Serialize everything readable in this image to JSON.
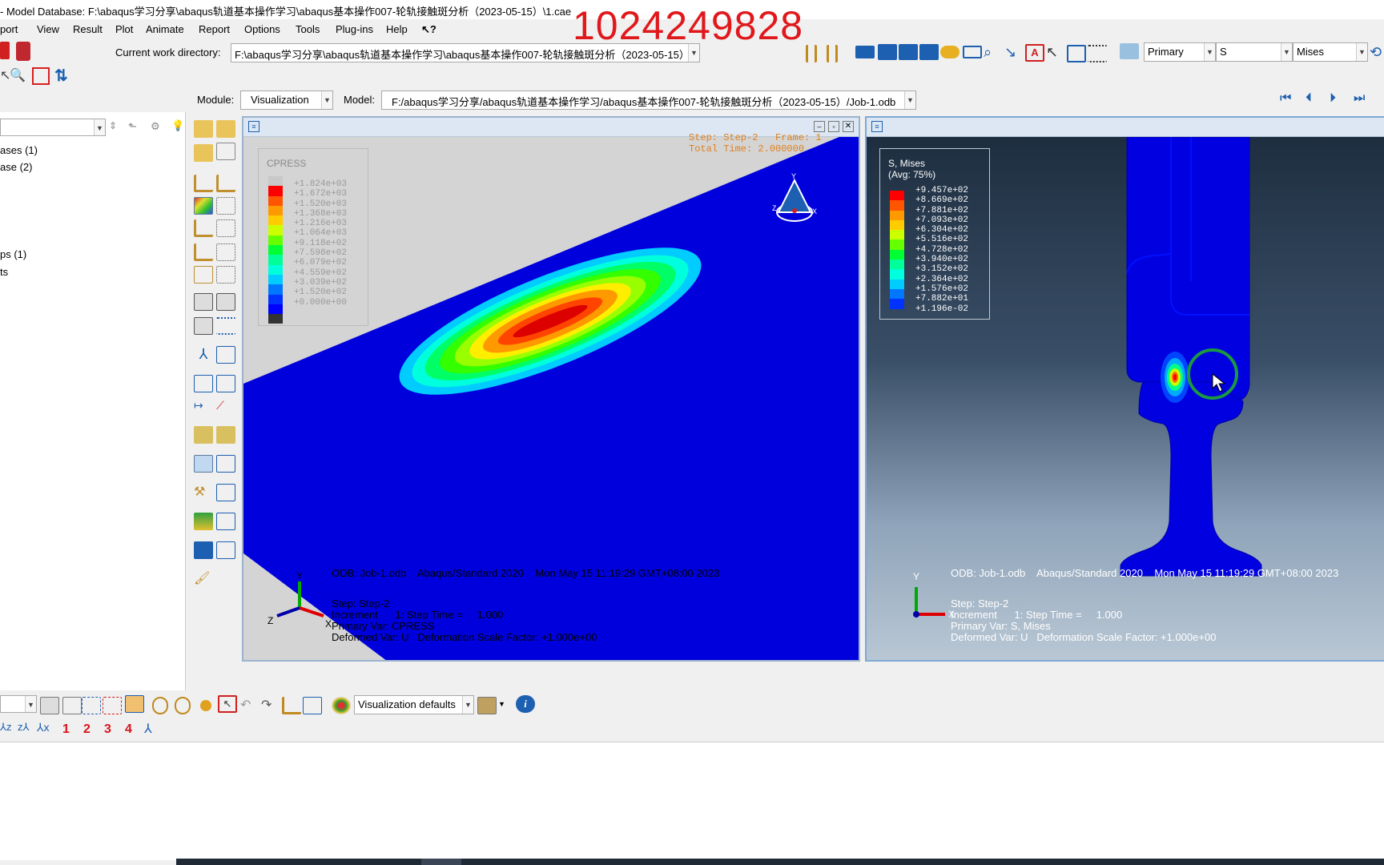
{
  "window": {
    "title": "- Model Database: F:\\abaqus学习分享\\abaqus轨道基本操作学习\\abaqus基本操作007-轮轨接触斑分析（2023-05-15）\\1.cae",
    "watermark": "1024249828"
  },
  "menu": [
    "port",
    "View",
    "Result",
    "Plot",
    "Animate",
    "Report",
    "Options",
    "Tools",
    "Plug-ins",
    "Help",
    "↖?"
  ],
  "cwd": {
    "label": "Current work directory:",
    "value": "F:\\abaqus学习分享\\abaqus轨道基本操作学习\\abaqus基本操作007-轮轨接触斑分析（2023-05-15）"
  },
  "field_output": {
    "step_type": "Primary",
    "variable": "S",
    "invariant": "Mises"
  },
  "context": {
    "module_label": "Module:",
    "module": "Visualization",
    "model_label": "Model:",
    "model": "F:/abaqus学习分享/abaqus轨道基本操作学习/abaqus基本操作007-轮轨接触斑分析（2023-05-15）/Job-1.odb"
  },
  "tree": [
    "ases (1)",
    "ase (2)",
    "ps (1)",
    "ts"
  ],
  "viewport1": {
    "legend_title": "CPRESS",
    "legend_values": [
      "+1.824e+03",
      "+1.672e+03",
      "+1.520e+03",
      "+1.368e+03",
      "+1.216e+03",
      "+1.064e+03",
      "+9.118e+02",
      "+7.598e+02",
      "+6.079e+02",
      "+4.559e+02",
      "+3.039e+02",
      "+1.520e+02",
      "+0.000e+00"
    ],
    "legend_colors": [
      "#ff0000",
      "#ff5500",
      "#ff9900",
      "#ffcc00",
      "#ccff00",
      "#66ff00",
      "#00ff33",
      "#00ff99",
      "#00ffdd",
      "#00ccff",
      "#0077ff",
      "#0033ff",
      "#0000ff"
    ],
    "step_frame": "Step: Step-2   Frame: 1",
    "total_time": "Total Time: 2.000000",
    "odb_line": "ODB: Job-1.odb    Abaqus/Standard 2020    Mon May 15 11:19:29 GMT+08:00 2023",
    "step_line": "Step: Step-2",
    "increment_line": "Increment      1: Step Time =     1.000",
    "primary_var": "Primary Var: CPRESS",
    "deformed_var": "Deformed Var: U   Deformation Scale Factor: +1.000e+00"
  },
  "viewport2": {
    "legend_title": "S, Mises",
    "legend_sub": "(Avg: 75%)",
    "legend_values": [
      "+9.457e+02",
      "+8.669e+02",
      "+7.881e+02",
      "+7.093e+02",
      "+6.304e+02",
      "+5.516e+02",
      "+4.728e+02",
      "+3.940e+02",
      "+3.152e+02",
      "+2.364e+02",
      "+1.576e+02",
      "+7.882e+01",
      "+1.196e-02"
    ],
    "legend_colors": [
      "#ff0000",
      "#ff5500",
      "#ff9900",
      "#ffcc00",
      "#ccff00",
      "#66ff00",
      "#00ff33",
      "#00ff99",
      "#00ffdd",
      "#00ccff",
      "#0077ff",
      "#0033ff"
    ],
    "odb_line": "ODB: Job-1.odb    Abaqus/Standard 2020    Mon May 15 11:19:29 GMT+08:00 2023",
    "step_line": "Step: Step-2",
    "increment_line": "Increment      1: Step Time =     1.000",
    "primary_var": "Primary Var: S, Mises",
    "deformed_var": "Deformed Var: U   Deformation Scale Factor: +1.000e+00"
  },
  "bottom": {
    "view_defaults": "Visualization defaults",
    "view_numbers": [
      "1",
      "2",
      "3",
      "4"
    ]
  }
}
